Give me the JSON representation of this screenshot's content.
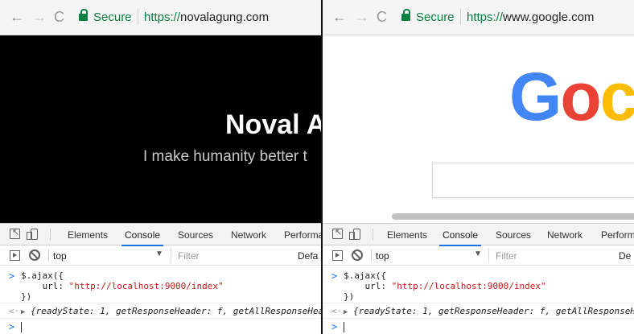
{
  "panes": [
    {
      "id": "left",
      "address": {
        "secure_label": "Secure",
        "url_protocol": "https://",
        "url_host": "novalagung.com"
      },
      "page": {
        "title": "Noval A",
        "subtitle": "I make humanity better t"
      },
      "devtools": {
        "tabs": [
          "Elements",
          "Console",
          "Sources",
          "Network",
          "Performa"
        ],
        "active_tab": "Console",
        "context": "top",
        "filter_placeholder": "Filter",
        "level_label": "Defa",
        "console": {
          "input_lines": [
            "$.ajax({",
            "    url: ",
            "})"
          ],
          "url_value": "\"http://localhost:9000/index\"",
          "response": "{readyState: 1, getResponseHeader: f, getAllResponseHead"
        }
      }
    },
    {
      "id": "right",
      "address": {
        "secure_label": "Secure",
        "url_protocol": "https://",
        "url_host": "www.google.com"
      },
      "page": {
        "logo_letters": [
          "G",
          "o",
          "c"
        ]
      },
      "devtools": {
        "tabs": [
          "Elements",
          "Console",
          "Sources",
          "Network",
          "Perform"
        ],
        "active_tab": "Console",
        "context": "top",
        "filter_placeholder": "Filter",
        "level_label": "De",
        "console": {
          "input_lines": [
            "$.ajax({",
            "    url: ",
            "})"
          ],
          "url_value": "\"http://localhost:9000/index\"",
          "response": "{readyState: 1, getResponseHeader: f, getAllResponseHea"
        }
      }
    }
  ],
  "symbols": {
    "back": "←",
    "forward": "→",
    "reload": "C",
    "prompt": ">",
    "response_prompt": "<·",
    "expand": "▶",
    "dropdown": "▼"
  },
  "colors": {
    "secure_green": "#0b8043",
    "google_blue": "#4285f4",
    "google_red": "#ea4335",
    "google_yellow": "#fbbc05",
    "active_tab_underline": "#1a73e8",
    "string_red": "#c41a16"
  }
}
